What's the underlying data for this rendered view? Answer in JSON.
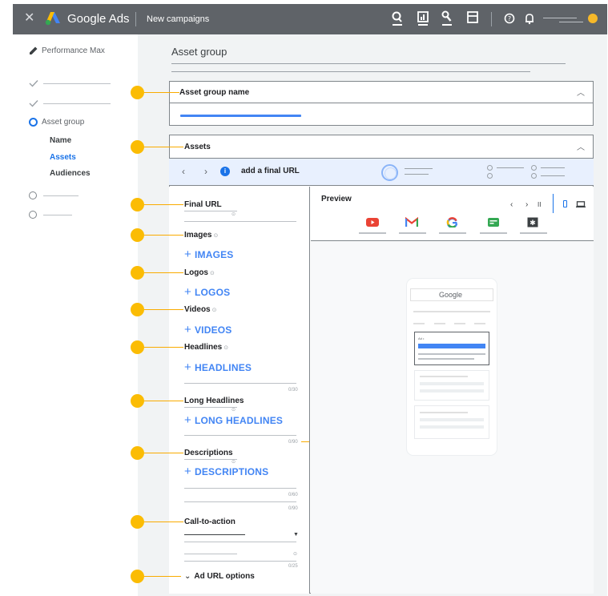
{
  "topbar": {
    "brand": "Google Ads",
    "breadcrumb": "New campaigns"
  },
  "nav": {
    "campaign_type": "Performance Max",
    "current_step": "Asset group",
    "substeps": [
      "Name",
      "Assets",
      "Audiences"
    ],
    "active_substep": "Assets"
  },
  "page": {
    "title": "Asset group"
  },
  "asset_group_card": {
    "title": "Asset group name"
  },
  "assets_card": {
    "title": "Assets",
    "banner_text": "add a final URL",
    "info_glyph": "i"
  },
  "form": {
    "final_url_label": "Final URL",
    "images_label": "Images",
    "images_button": "IMAGES",
    "logos_label": "Logos",
    "logos_button": "LOGOS",
    "videos_label": "Videos",
    "videos_button": "VIDEOS",
    "headlines_label": "Headlines",
    "headlines_button": "HEADLINES",
    "long_headlines_label": "Long Headlines",
    "long_headlines_button": "LONG HEADLINES",
    "descriptions_label": "Descriptions",
    "descriptions_button": "DESCRIPTIONS",
    "cta_label": "Call-to-action",
    "ad_url_options": "Ad URL options",
    "counters": {
      "headlines": "0/30",
      "long_headlines": "0/90",
      "descriptions_1": "0/60",
      "descriptions_2": "0/90",
      "cta": "0/25"
    },
    "hint_glyph": "⊙",
    "plus_glyph": "+"
  },
  "preview": {
    "title": "Preview",
    "google_logo": "Google",
    "ad_tag": "Ad •",
    "prev_glyph": "‹",
    "next_glyph": "›",
    "pause_glyph": "II",
    "apps": [
      "youtube-icon",
      "gmail-icon",
      "google-search-icon",
      "discover-icon",
      "display-icon"
    ]
  },
  "colors": {
    "topbar": "#5f6368",
    "accent_blue": "#1a73e8",
    "callout_orange": "#fbbc04",
    "banner_bg": "#e8f0fe"
  }
}
